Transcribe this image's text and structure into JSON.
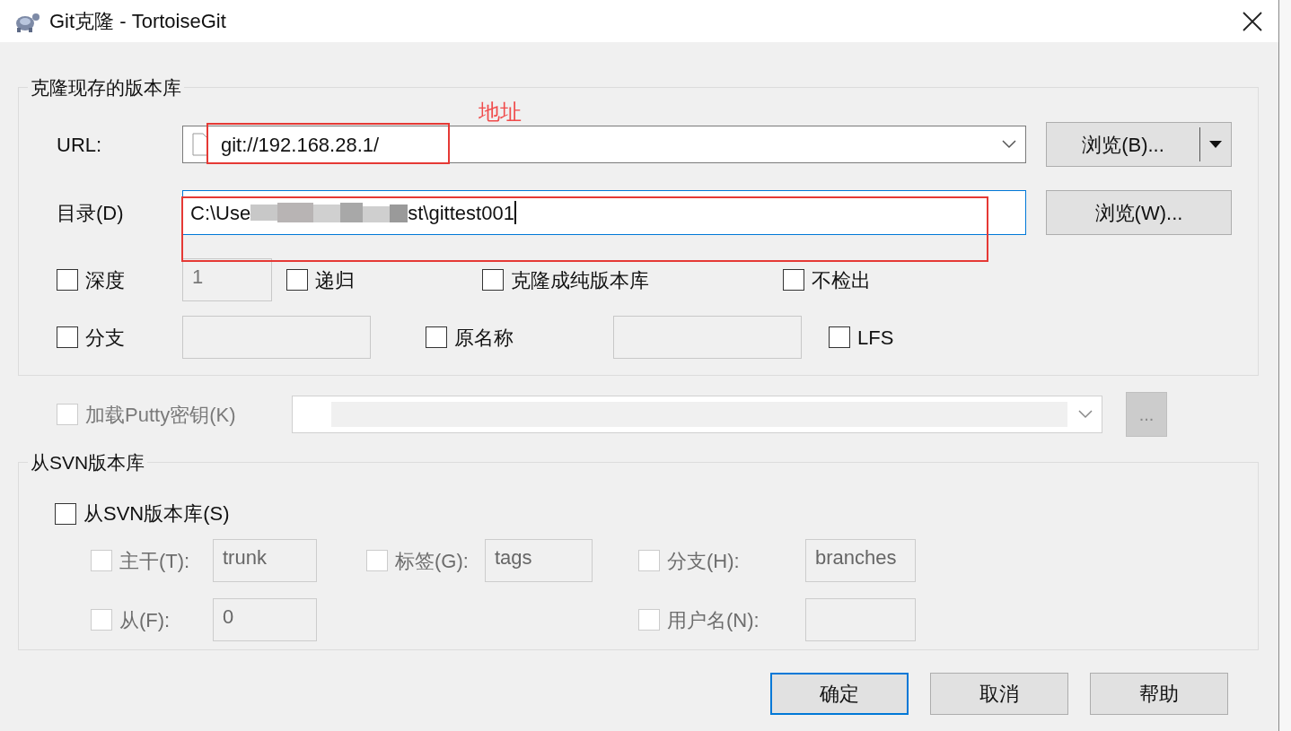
{
  "window": {
    "title": "Git克隆 - TortoiseGit"
  },
  "clone_group": {
    "title": "克隆现存的版本库",
    "url": {
      "label": "URL:",
      "value": "git://192.168.28.1/",
      "browse_button": "浏览(B)..."
    },
    "directory": {
      "label": "目录(D)",
      "value_start": "C:\\Use",
      "value_end": "st\\gittest001",
      "browse_button": "浏览(W)..."
    },
    "option_rows": [
      [
        {
          "kind": "checkbox_field",
          "label": "深度",
          "checked": false,
          "field": "1"
        },
        {
          "kind": "checkbox",
          "label": "递归",
          "checked": false
        },
        {
          "kind": "checkbox",
          "label": "克隆成纯版本库",
          "checked": false
        },
        {
          "kind": "checkbox",
          "label": "不检出",
          "checked": false
        }
      ],
      [
        {
          "kind": "checkbox_field",
          "label": "分支",
          "checked": false
        },
        {
          "kind": "checkbox_field",
          "label": "原名称",
          "checked": false
        },
        {
          "kind": "checkbox",
          "label": "LFS",
          "checked": false
        }
      ]
    ]
  },
  "putty": {
    "label": "加载Putty密钥(K)",
    "checked": false,
    "disabled": true,
    "more_button": "..."
  },
  "svn_group": {
    "title": "从SVN版本库",
    "enable": {
      "label": "从SVN版本库(S)",
      "checked": false
    },
    "fields": [
      {
        "label": "主干(T):",
        "checked": false,
        "disabled": true,
        "value": "trunk"
      },
      {
        "label": "标签(G):",
        "checked": false,
        "disabled": true,
        "value": "tags"
      },
      {
        "label": "分支(H):",
        "checked": false,
        "disabled": true,
        "value": "branches"
      },
      {
        "label": "从(F):",
        "checked": false,
        "disabled": true,
        "value": "0"
      },
      {
        "label": "用户名(N):",
        "checked": false,
        "disabled": true
      }
    ]
  },
  "buttons": [
    {
      "label": "确定",
      "default": true
    },
    {
      "label": "取消",
      "default": false
    },
    {
      "label": "帮助",
      "default": false
    }
  ],
  "annotation": {
    "note": "地址"
  }
}
